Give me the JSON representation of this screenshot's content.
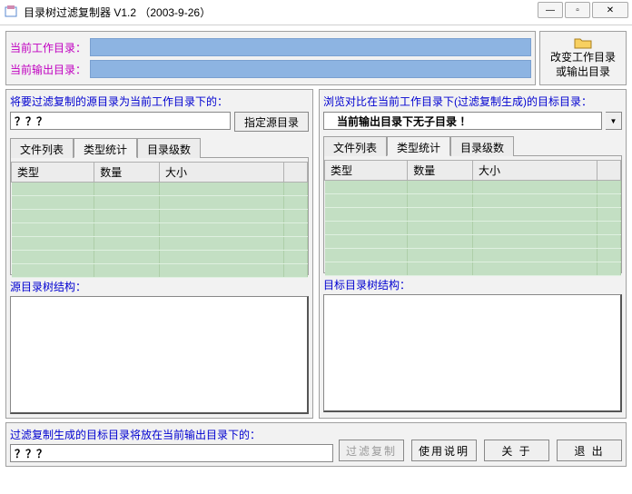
{
  "window": {
    "title": "目录树过滤复制器 V1.2 （2003-9-26）"
  },
  "top": {
    "work_dir_label": "当前工作目录：",
    "out_dir_label": "当前输出目录：",
    "change_btn_line1": "改变工作目录",
    "change_btn_line2": "或输出目录"
  },
  "left_panel": {
    "header": "将要过滤复制的源目录为当前工作目录下的：",
    "input_value": "？？？",
    "src_btn": "指定源目录",
    "tree_label": "源目录树结构："
  },
  "right_panel": {
    "header": "浏览对比在当前工作目录下(过滤复制生成)的目标目录：",
    "dropdown_value": "当前输出目录下无子目录 ！",
    "tree_label": "目标目录树结构："
  },
  "tabs": {
    "t1": "文件列表",
    "t2": "类型统计",
    "t3": "目录级数"
  },
  "grid": {
    "col1": "类型",
    "col2": "数量",
    "col3": "大小"
  },
  "bottom": {
    "label": "过滤复制生成的目标目录将放在当前输出目录下的：",
    "input_value": "？？？",
    "btn_filter": "过滤复制",
    "btn_help": "使用说明",
    "btn_about": "关 于",
    "btn_exit": "退 出"
  }
}
